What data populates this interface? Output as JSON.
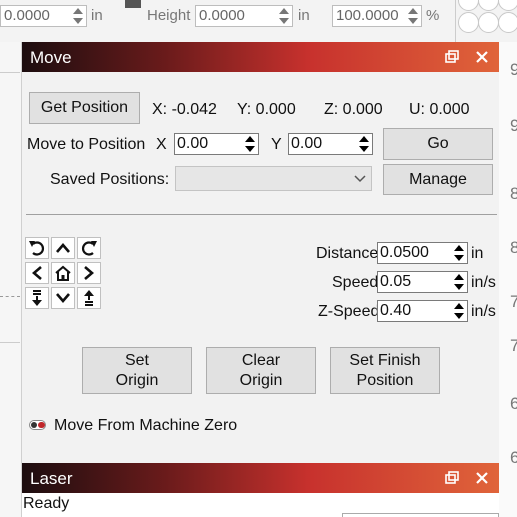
{
  "toolbar": {
    "width_value": "0.0000",
    "width_unit": "in",
    "height_label": "Height",
    "height_value": "0.0000",
    "height_unit": "in",
    "percent_value": "100.0000",
    "percent_unit": "%"
  },
  "right_ruler": [
    "9",
    "9",
    "8",
    "8",
    "7",
    "7",
    "6",
    "6"
  ],
  "move_panel": {
    "title": "Move",
    "get_position_label": "Get Position",
    "pos_x": "X: -0.042",
    "pos_y": "Y: 0.000",
    "pos_z": "Z: 0.000",
    "pos_u": "U: 0.000",
    "move_to_label": "Move to Position",
    "x_label": "X",
    "x_value": "0.00",
    "y_label": "Y",
    "y_value": "0.00",
    "go_label": "Go",
    "saved_label": "Saved Positions:",
    "saved_value": "",
    "manage_label": "Manage",
    "distance_label": "Distance",
    "distance_value": "0.0500",
    "distance_unit": "in",
    "speed_label": "Speed",
    "speed_value": "0.05",
    "speed_unit": "in/s",
    "zspeed_label": "Z-Speed",
    "zspeed_value": "0.40",
    "zspeed_unit": "in/s",
    "set_origin_label": "Set\nOrigin",
    "clear_origin_label": "Clear\nOrigin",
    "set_finish_label": "Set Finish\nPosition",
    "machine_zero_label": "Move From Machine Zero",
    "machine_zero_on": false
  },
  "laser_panel": {
    "title": "Laser",
    "status": "Ready"
  },
  "colors": {
    "header_gradient": [
      "#1c0d0f",
      "#6a1b1b",
      "#c7312d",
      "#e0643a"
    ],
    "toggle_off": "#c0262a"
  }
}
